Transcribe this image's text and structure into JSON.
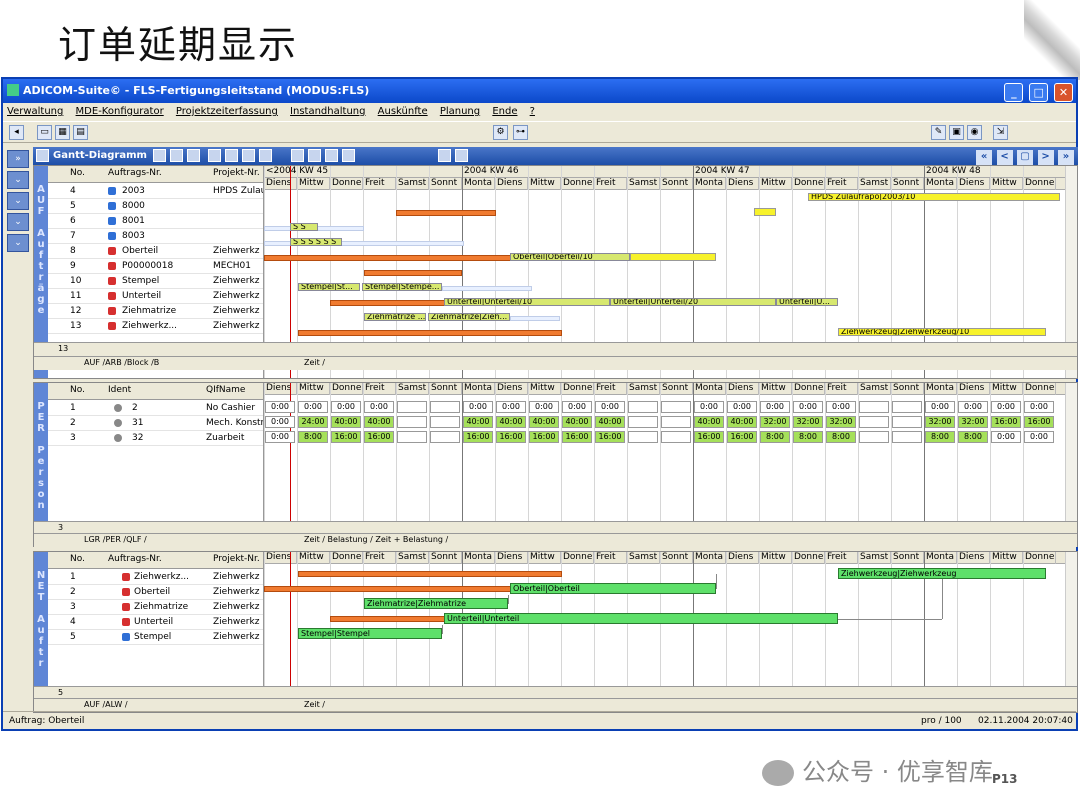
{
  "slide": {
    "title": "订单延期显示",
    "watermark": "公众号 · 优享智库",
    "page_number": "P13"
  },
  "window": {
    "title": "ADICOM-Suite© - FLS-Fertigungsleitstand (MODUS:FLS)",
    "min": "_",
    "max": "□",
    "close": "✕"
  },
  "menu": [
    "Verwaltung",
    "MDE-Konfigurator",
    "Projektzeiterfassung",
    "Instandhaltung",
    "Auskünfte",
    "Planung",
    "Ende",
    "?"
  ],
  "gantt_header": {
    "title": "Gantt-Diagramm",
    "nav": [
      "«",
      "<",
      "▢",
      ">",
      "»"
    ]
  },
  "weeks": [
    "<2004 KW 45",
    "2004 KW 46",
    "2004 KW 47",
    "2004 KW 48"
  ],
  "days": [
    "Diens",
    "Mittw",
    "Donne",
    "Freit",
    "Samst",
    "Sonnt",
    "Monta",
    "Diens",
    "Mittw",
    "Donne",
    "Freit",
    "Samst",
    "Sonnt",
    "Monta",
    "Diens",
    "Mittw",
    "Donne",
    "Freit",
    "Samst",
    "Sonnt",
    "Monta",
    "Diens",
    "Mittw",
    "Donne"
  ],
  "top": {
    "label": "AUF Aufträge",
    "columns": [
      "No.",
      "Auftrags-Nr.",
      "Projekt-Nr."
    ],
    "rows": [
      {
        "no": "4",
        "order": "2003",
        "project": "HPDS Zulauf..."
      },
      {
        "no": "5",
        "order": "8000",
        "project": ""
      },
      {
        "no": "6",
        "order": "8001",
        "project": ""
      },
      {
        "no": "7",
        "order": "8003",
        "project": ""
      },
      {
        "no": "8",
        "order": "Oberteil",
        "project": "Ziehwerkz"
      },
      {
        "no": "9",
        "order": "P00000018",
        "project": "MECH01"
      },
      {
        "no": "10",
        "order": "Stempel",
        "project": "Ziehwerkz"
      },
      {
        "no": "11",
        "order": "Unterteil",
        "project": "Ziehwerkz"
      },
      {
        "no": "12",
        "order": "Ziehmatrize",
        "project": "Ziehwerkz"
      },
      {
        "no": "13",
        "order": "Ziehwerkz...",
        "project": "Ziehwerkz"
      }
    ],
    "count": "13",
    "tabs": "AUF /ARB /Block /B",
    "chart_tab": "Zeit /",
    "bar_labels": {
      "hpds": "HPDS Zulaufrapo|2003/10",
      "ober": "Oberteil|Oberteil/10",
      "stem1": "Stempel|St...",
      "stem2": "Stempel|Stempe...",
      "unt1": "Unterteil|Unterteil/10",
      "unt2": "Unterteil|Unterteil/20",
      "unt3": "Unterteil|U...",
      "zm1": "Ziehmatrize ...",
      "zm2": "Ziehmatrize|Zieh...",
      "zw": "Ziehwerkzeug|Ziehwerkzeug/10",
      "s6": "S S",
      "s7": "S S S S S S"
    }
  },
  "middle": {
    "label": "PER Personal",
    "columns": [
      "No.",
      "Ident",
      "QIfName"
    ],
    "rows": [
      {
        "no": "1",
        "ident": "2",
        "name": "No Cashier",
        "hours": [
          "0:00",
          "0:00",
          "0:00",
          "0:00",
          "",
          "",
          "0:00",
          "0:00",
          "0:00",
          "0:00",
          "0:00",
          "",
          "",
          "0:00",
          "0:00",
          "0:00",
          "0:00",
          "0:00",
          "",
          "",
          "0:00",
          "0:00",
          "0:00",
          "0:00"
        ]
      },
      {
        "no": "2",
        "ident": "31",
        "name": "Mech. Konstru...",
        "hours": [
          "0:00",
          "24:00",
          "40:00",
          "40:00",
          "",
          "",
          "40:00",
          "40:00",
          "40:00",
          "40:00",
          "40:00",
          "",
          "",
          "40:00",
          "40:00",
          "32:00",
          "32:00",
          "32:00",
          "",
          "",
          "32:00",
          "32:00",
          "16:00",
          "16:00"
        ]
      },
      {
        "no": "3",
        "ident": "32",
        "name": "Zuarbeit",
        "hours": [
          "0:00",
          "8:00",
          "16:00",
          "16:00",
          "",
          "",
          "16:00",
          "16:00",
          "16:00",
          "16:00",
          "16:00",
          "",
          "",
          "16:00",
          "16:00",
          "8:00",
          "8:00",
          "8:00",
          "",
          "",
          "8:00",
          "8:00",
          "0:00",
          "0:00"
        ]
      }
    ],
    "count": "3",
    "tabs": "LGR /PER /QLF /",
    "chart_tab": "Zeit / Belastung / Zeit + Belastung /"
  },
  "bottom": {
    "label": "NET Aufträge",
    "columns": [
      "No.",
      "Auftrags-Nr.",
      "Projekt-Nr."
    ],
    "rows": [
      {
        "no": "1",
        "order": "Ziehwerkz...",
        "project": "Ziehwerkz"
      },
      {
        "no": "2",
        "order": "Oberteil",
        "project": "Ziehwerkz"
      },
      {
        "no": "3",
        "order": "Ziehmatrize",
        "project": "Ziehwerkz"
      },
      {
        "no": "4",
        "order": "Unterteil",
        "project": "Ziehwerkz"
      },
      {
        "no": "5",
        "order": "Stempel",
        "project": "Ziehwerkz"
      }
    ],
    "count": "5",
    "tabs": "AUF /ALW /",
    "chart_tab": "Zeit /",
    "bar_labels": {
      "zw": "Ziehwerkzeug|Ziehwerkzeug",
      "ober": "Oberteil|Oberteil",
      "zm": "Ziehmatrize|Ziehmatrize",
      "unt": "Unterteil|Unterteil",
      "stem": "Stempel|Stempel"
    }
  },
  "status": {
    "left": "Auftrag: Oberteil",
    "mid": "pro / 100",
    "right": "02.11.2004  20:07:40"
  }
}
